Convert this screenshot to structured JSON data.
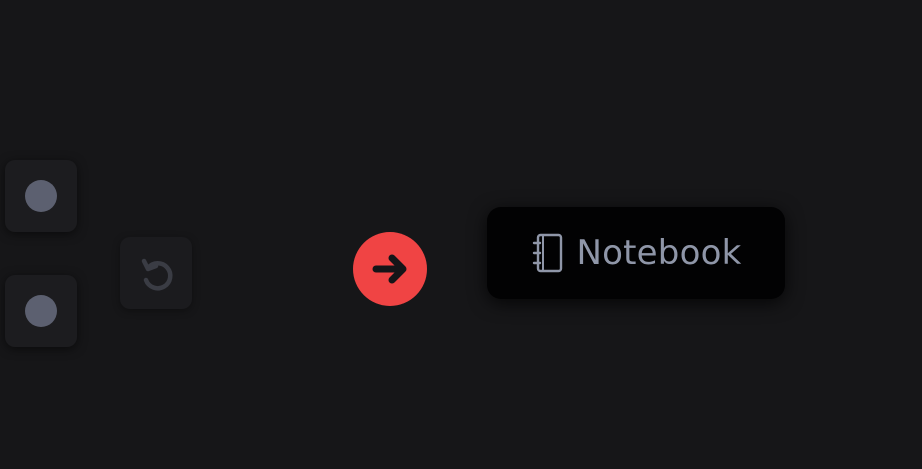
{
  "toolbar": {
    "icons": [
      "dot-icon",
      "dot-icon",
      "undo-icon",
      "arrow-right-icon",
      "notebook-icon"
    ]
  },
  "notebook_button": {
    "label": "Notebook"
  },
  "colors": {
    "background": "#161618",
    "tile": "#1c1c1f",
    "dot": "#5c6070",
    "accent": "#f04444",
    "notebook_text": "#8f96a8",
    "undo_icon": "#3a3c44"
  }
}
